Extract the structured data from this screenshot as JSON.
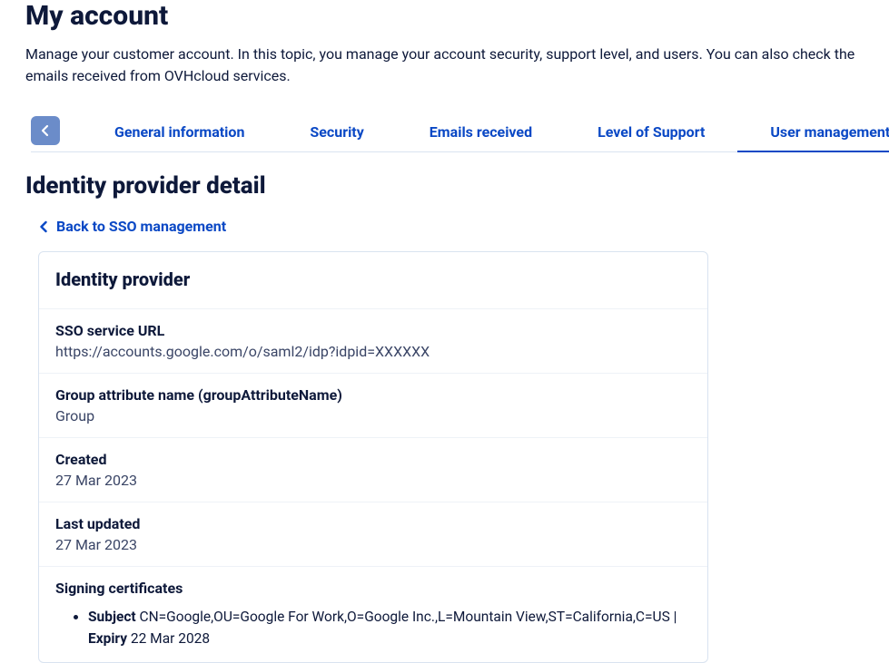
{
  "header": {
    "title": "My account",
    "description": "Manage your customer account. In this topic, you manage your account security, support level, and users. You can also check the emails received from OVHcloud services."
  },
  "tabs": [
    {
      "label": "General information",
      "active": false
    },
    {
      "label": "Security",
      "active": false
    },
    {
      "label": "Emails received",
      "active": false
    },
    {
      "label": "Level of Support",
      "active": false
    },
    {
      "label": "User management",
      "active": true
    }
  ],
  "section": {
    "title": "Identity provider detail",
    "backlink": "Back to SSO management"
  },
  "card": {
    "title": "Identity provider",
    "fields": {
      "sso_url_label": "SSO service URL",
      "sso_url_value": "https://accounts.google.com/o/saml2/idp?idpid=XXXXXX",
      "group_attr_label": "Group attribute name (groupAttributeName)",
      "group_attr_value": "Group",
      "created_label": "Created",
      "created_value": "27 Mar 2023",
      "updated_label": "Last updated",
      "updated_value": "27 Mar 2023",
      "certs_label": "Signing certificates",
      "certs": [
        {
          "subject_label": "Subject",
          "subject_value": "CN=Google,OU=Google For Work,O=Google Inc.,L=Mountain View,ST=California,C=US |",
          "expiry_label": "Expiry",
          "expiry_value": "22 Mar 2028"
        }
      ]
    }
  }
}
